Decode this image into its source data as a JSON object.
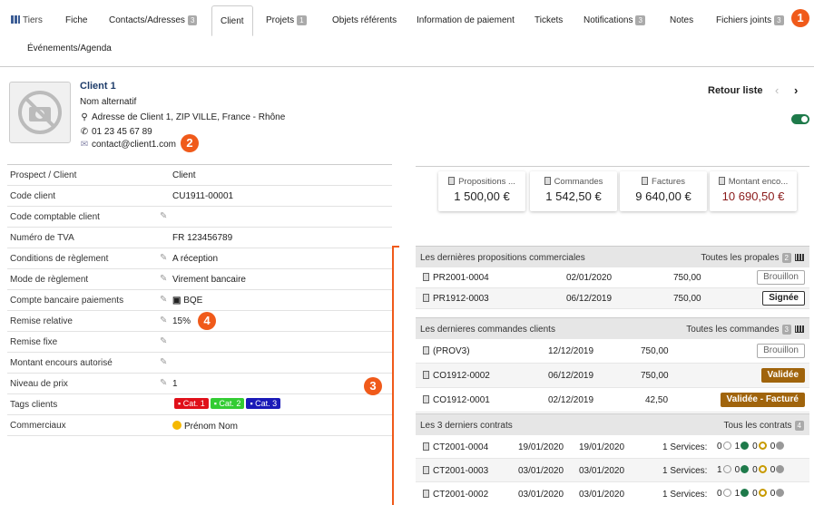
{
  "tabs": {
    "tiers": "Tiers",
    "items": [
      {
        "label": "Fiche"
      },
      {
        "label": "Contacts/Adresses",
        "badge": "3"
      },
      {
        "label": "Client"
      },
      {
        "label": "Projets",
        "badge": "1"
      },
      {
        "label": "Objets référents"
      },
      {
        "label": "Information de paiement"
      },
      {
        "label": "Tickets"
      },
      {
        "label": "Notifications",
        "badge": "3"
      },
      {
        "label": "Notes"
      },
      {
        "label": "Fichiers joints",
        "badge": "3"
      }
    ],
    "second_row": "Événements/Agenda"
  },
  "markers": [
    "1",
    "2",
    "3",
    "4"
  ],
  "header": {
    "name": "Client 1",
    "alt_name": "Nom alternatif",
    "address": "Adresse de Client 1, ZIP VILLE, France - Rhône",
    "phone": "01 23 45 67 89",
    "email": "contact@client1.com",
    "retour": "Retour liste",
    "prev": "‹",
    "next": "›"
  },
  "fields": [
    {
      "label": "Prospect / Client",
      "value": "Client"
    },
    {
      "label": "Code client",
      "value": "CU1911-00001"
    },
    {
      "label": "Code comptable client",
      "value": ""
    },
    {
      "label": "Numéro de TVA",
      "value": "FR 123456789"
    },
    {
      "label": "Conditions de règlement",
      "value": "A réception"
    },
    {
      "label": "Mode de règlement",
      "value": "Virement bancaire"
    },
    {
      "label": "Compte bancaire paiements",
      "value": "BQE"
    },
    {
      "label": "Remise relative",
      "value": "15%"
    },
    {
      "label": "Remise fixe",
      "value": ""
    },
    {
      "label": "Montant encours autorisé",
      "value": ""
    },
    {
      "label": "Niveau de prix",
      "value": "1"
    },
    {
      "label": "Tags clients",
      "value": ""
    },
    {
      "label": "Commerciaux",
      "value": "Prénom Nom"
    }
  ],
  "tags": [
    {
      "label": "Cat. 1",
      "color": "#e0101a"
    },
    {
      "label": "Cat. 2",
      "color": "#33cc33"
    },
    {
      "label": "Cat. 3",
      "color": "#1a1ab8"
    }
  ],
  "stats": [
    {
      "title": "Propositions ...",
      "value": "1 500,00 €"
    },
    {
      "title": "Commandes",
      "value": "1 542,50 €"
    },
    {
      "title": "Factures",
      "value": "9 640,00 €"
    },
    {
      "title": "Montant enco...",
      "value": "10 690,50 €"
    }
  ],
  "propals": {
    "title": "Les dernières propositions commerciales",
    "link": "Toutes les propales",
    "badge": "2",
    "rows": [
      {
        "ref": "PR2001-0004",
        "date": "02/01/2020",
        "amount": "750,00",
        "status": "Brouillon"
      },
      {
        "ref": "PR1912-0003",
        "date": "06/12/2019",
        "amount": "750,00",
        "status": "Signée"
      }
    ]
  },
  "commandes": {
    "title": "Les dernieres commandes clients",
    "link": "Toutes les commandes",
    "badge": "3",
    "rows": [
      {
        "ref": "(PROV3)",
        "date": "12/12/2019",
        "amount": "750,00",
        "status": "Brouillon"
      },
      {
        "ref": "CO1912-0002",
        "date": "06/12/2019",
        "amount": "750,00",
        "status": "Validée"
      },
      {
        "ref": "CO1912-0001",
        "date": "02/12/2019",
        "amount": "42,50",
        "status": "Validée - Facturé"
      }
    ]
  },
  "contrats": {
    "title": "Les 3 derniers contrats",
    "link": "Tous les contrats",
    "badge": "4",
    "rows": [
      {
        "ref": "CT2001-0004",
        "d1": "19/01/2020",
        "d2": "19/01/2020",
        "services": "1 Services:",
        "n": [
          "0",
          "1",
          "0",
          "0"
        ]
      },
      {
        "ref": "CT2001-0003",
        "d1": "03/01/2020",
        "d2": "03/01/2020",
        "services": "1 Services:",
        "n": [
          "1",
          "0",
          "0",
          "0"
        ]
      },
      {
        "ref": "CT2001-0002",
        "d1": "03/01/2020",
        "d2": "03/01/2020",
        "services": "1 Services:",
        "n": [
          "0",
          "1",
          "0",
          "0"
        ]
      }
    ]
  }
}
